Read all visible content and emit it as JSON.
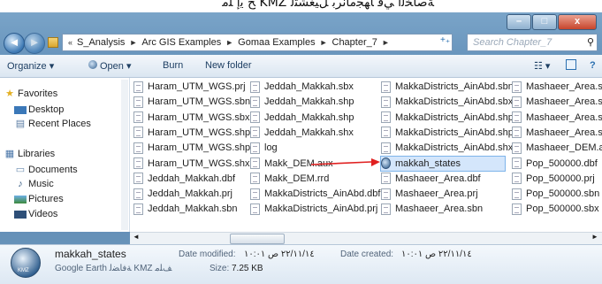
{
  "caption": {
    "text": "ﺦ ﻳﺇ ﻠﻣ KMZ ﺔﺻﺎﺨﻟﺍ ﻲﻓ ﺎﻬﺠﻣﺎﻧﺮﺑ ﻞﻴﻐﺸﺘﻟ"
  },
  "window": {
    "minimize": "–",
    "maximize": "□",
    "close": "x"
  },
  "nav": {
    "back": "◄",
    "forward": "►"
  },
  "address": {
    "overflow": "«",
    "segments": [
      "S_Analysis",
      "Arc GIS Examples",
      "Gomaa Examples",
      "Chapter_7"
    ],
    "separator": "►",
    "refresh": "+₊"
  },
  "search": {
    "placeholder": "Search Chapter_7"
  },
  "toolbar": {
    "organize": "Organize ▾",
    "open": "Open ▾",
    "burn": "Burn",
    "new_folder": "New folder",
    "views": "☷ ▾",
    "help": "?"
  },
  "sidebar": {
    "favorites": "Favorites",
    "desktop": "Desktop",
    "recent_places": "Recent Places",
    "libraries": "Libraries",
    "documents": "Documents",
    "music": "Music",
    "pictures": "Pictures",
    "videos": "Videos"
  },
  "files": {
    "col1": [
      "Haram_UTM_WGS.prj",
      "Haram_UTM_WGS.sbn",
      "Haram_UTM_WGS.sbx",
      "Haram_UTM_WGS.shp",
      "Haram_UTM_WGS.shp",
      "Haram_UTM_WGS.shx",
      "Jeddah_Makkah.dbf",
      "Jeddah_Makkah.prj",
      "Jeddah_Makkah.sbn"
    ],
    "col2": [
      "Jeddah_Makkah.sbx",
      "Jeddah_Makkah.shp",
      "Jeddah_Makkah.shp",
      "Jeddah_Makkah.shx",
      "log",
      "Makk_DEM.aux",
      "Makk_DEM.rrd",
      "MakkaDistricts_AinAbd.dbf",
      "MakkaDistricts_AinAbd.prj"
    ],
    "col3": [
      "MakkaDistricts_AinAbd.sbn",
      "MakkaDistricts_AinAbd.sbx",
      "MakkaDistricts_AinAbd.shp",
      "MakkaDistricts_AinAbd.shp",
      "MakkaDistricts_AinAbd.shx",
      "makkah_states",
      "Mashaeer_Area.dbf",
      "Mashaeer_Area.prj",
      "Mashaeer_Area.sbn"
    ],
    "col4": [
      "Mashaeer_Area.sbx",
      "Mashaeer_Area.shp",
      "Mashaeer_Area.shp",
      "Mashaeer_Area.shx",
      "Mashaeer_DEM.aux",
      "Pop_500000.dbf",
      "Pop_500000.prj",
      "Pop_500000.sbn",
      "Pop_500000.sbx"
    ]
  },
  "details": {
    "name": "makkah_states",
    "type": "Google Earth ﺔﻓﺎﻀﻟ KMZ ﻒﻠﻣ",
    "modified_label": "Date modified:",
    "modified_value": "٢٢/١١/١٤ ﺹ ١٠:٠١",
    "size_label": "Size:",
    "size_value": "7.25 KB",
    "created_label": "Date created:",
    "created_value": "٢٢/١١/١٤ ﺹ ١٠:٠١",
    "icon_text": "KMZ"
  },
  "colors": {
    "frame": "#5a87b2",
    "selection": "#d4e6fb",
    "arrow": "#e02020"
  }
}
